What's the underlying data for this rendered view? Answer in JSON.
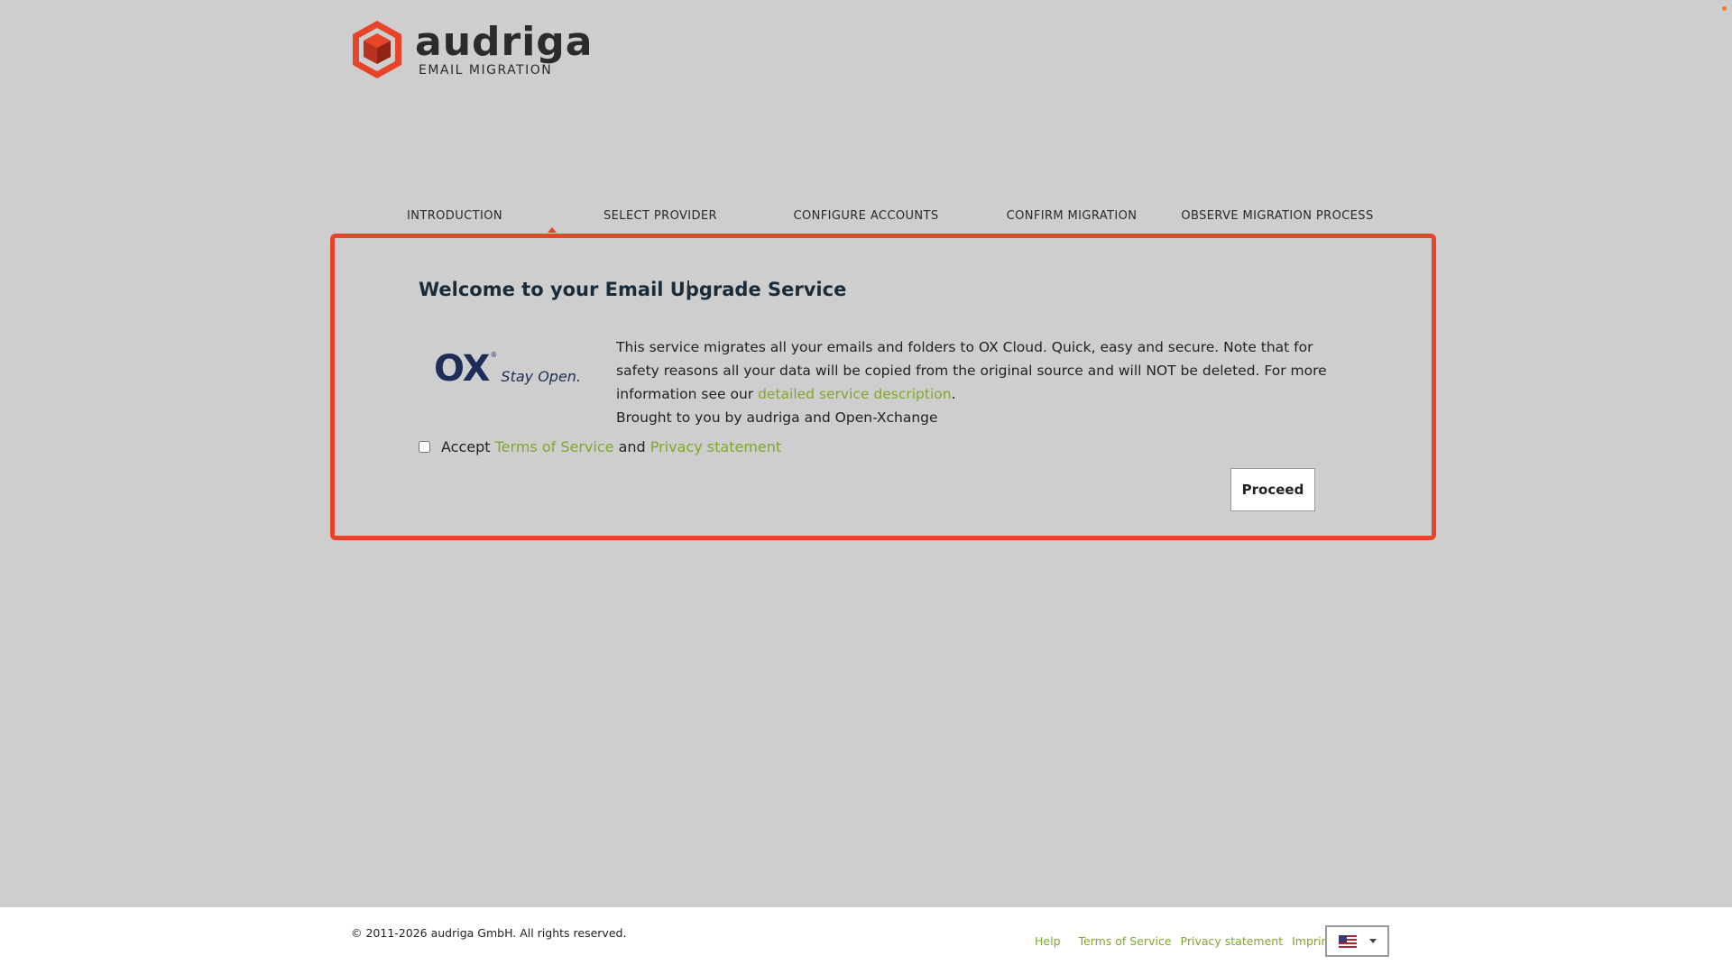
{
  "brand": {
    "name": "audriga",
    "subtitle": "EMAIL MIGRATION",
    "accent_color": "#e7442a"
  },
  "steps": [
    {
      "label": "INTRODUCTION",
      "active": true
    },
    {
      "label": "SELECT PROVIDER",
      "active": false
    },
    {
      "label": "CONFIGURE ACCOUNTS",
      "active": false
    },
    {
      "label": "CONFIRM MIGRATION",
      "active": false
    },
    {
      "label": "OBSERVE MIGRATION PROCESS",
      "active": false
    }
  ],
  "card": {
    "title": "Welcome to your Email Upgrade Service",
    "ox_logo": {
      "mark": "OX",
      "reg": "®",
      "tagline": "Stay Open."
    },
    "description_part1": "This service migrates all your emails and folders to OX Cloud. Quick, easy and secure. Note that for safety reasons all your data will be copied from the original source and will NOT be deleted. For more information see our ",
    "description_link": "detailed service description",
    "description_part2": ".",
    "description_line2": "Brought to you by audriga and Open-Xchange",
    "accept": {
      "checked": false,
      "prefix": "Accept",
      "tos_link": "Terms of Service",
      "and": "and",
      "privacy_link": "Privacy statement"
    },
    "proceed_label": "Proceed",
    "link_color": "#7fa82a"
  },
  "footer": {
    "copyright": "© 2011-2026 audriga GmbH. All rights reserved.",
    "links": [
      "Help",
      "Terms of Service",
      "Privacy statement",
      "Imprint"
    ],
    "language": {
      "selected": "us-flag-icon"
    }
  }
}
